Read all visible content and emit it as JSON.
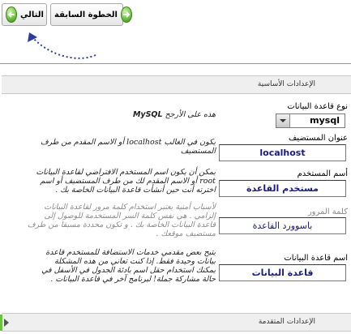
{
  "toolbar": {
    "next_label": "التالي",
    "prev_label": "الخطوة السابقة"
  },
  "basic_section": {
    "title": "الإعدادات الأساسية"
  },
  "db_type": {
    "label": "نوع قاعدة البيانات",
    "value": "mysql",
    "help_prefix": "هذه على الأرجح",
    "help_bold": "MySQL"
  },
  "host": {
    "label": "عنوان المستضيف",
    "value": "localhost",
    "help_line1": "يكون في الغالب localhost أو الاسم المقدم من طرف",
    "help_line2": "المستضيف"
  },
  "username": {
    "label": "أسم المستخدم",
    "value": "مستخدم القاعدة",
    "help_line1": "يمكن أن يكون اسم المستخدم الافتراضي لقاعدة البيانات",
    "help_line2": "root أو الاسم المقدم لك من طرف المستضيف أو اسم",
    "help_line3": "اخترته أنت حين أنشأت قاعدة البيانات الخاصة بك ."
  },
  "password": {
    "label": "كلمة المرور",
    "value": "باسوورد القاعدة",
    "help_line1": "لأسباب أمنية يعتبر استخدام كلمة مرور لقاعدة البيانات",
    "help_line2": "إلزامي . هي نفس كلمة السر المستخدمة للوصول إلى",
    "help_line3": "قاعدة البيانات الخاصة بك . و تكون محددة مسبقا من طرف",
    "help_line4": "مستضيف موقعك ."
  },
  "db_name": {
    "label": "اسم قاعدة البيانات",
    "value": "قاعدة البيانات",
    "help_line1": "يتيح بعض مقدمي خدمات الاستضافة للمستخدم قاعدة",
    "help_line2": "بيانات وحيدة فقط. إذا كنت تعاني من هذه المشكلة",
    "help_line3": "يمكنك استخدام حقل اسم بادئة الجدول في الأسفل في",
    "help_line4": "حالة مشاركة جملة! لبرنامج آخر في قاعدة البيانات ."
  },
  "advanced_section": {
    "title": "الإعدادات المتقدمة"
  },
  "colors": {
    "accent_green": "#6cc23c",
    "input_text": "#1a1a80",
    "arrow_blue": "#2a3c9c"
  }
}
